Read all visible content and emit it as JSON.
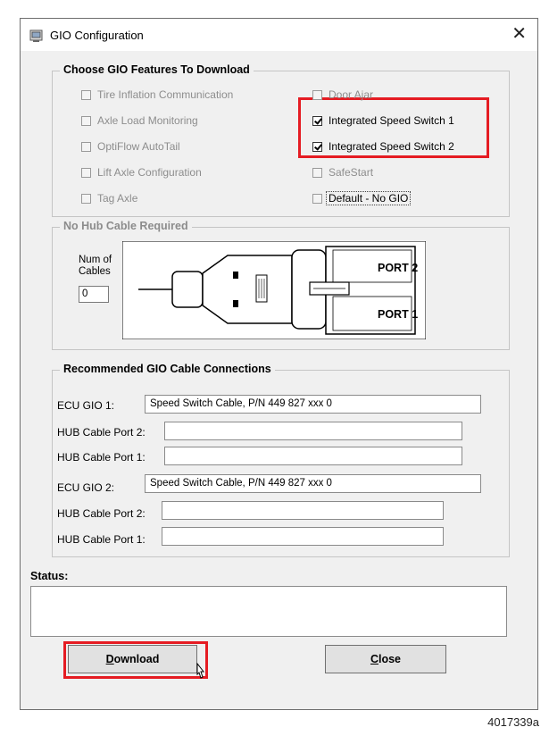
{
  "window": {
    "title": "GIO Configuration",
    "close_glyph": "✕"
  },
  "features": {
    "legend": "Choose GIO Features To Download",
    "left": [
      {
        "label": "Tire Inflation Communication",
        "checked": false,
        "enabled": false
      },
      {
        "label": "Axle Load Monitoring",
        "checked": false,
        "enabled": false
      },
      {
        "label": "OptiFlow AutoTail",
        "checked": false,
        "enabled": false
      },
      {
        "label": "Lift Axle Configuration",
        "checked": false,
        "enabled": false
      },
      {
        "label": "Tag Axle",
        "checked": false,
        "enabled": false
      }
    ],
    "right": [
      {
        "label": "Door Ajar",
        "checked": false,
        "enabled": false
      },
      {
        "label": "Integrated Speed Switch 1",
        "checked": true,
        "enabled": true
      },
      {
        "label": "Integrated Speed Switch 2",
        "checked": true,
        "enabled": true
      },
      {
        "label": "SafeStart",
        "checked": false,
        "enabled": false
      },
      {
        "label": "Default - No GIO",
        "checked": false,
        "enabled": true
      }
    ]
  },
  "hub": {
    "legend": "No Hub Cable Required",
    "num_label_line1": "Num of",
    "num_label_line2": "Cables",
    "num_value": "0",
    "port2_label": "PORT 2",
    "port1_label": "PORT 1"
  },
  "connections": {
    "legend": "Recommended GIO Cable Connections",
    "ecu1_label": "ECU GIO 1:",
    "ecu1_value": "Speed Switch Cable, P/N 449 827 xxx 0",
    "hub1_port2_label": "HUB Cable Port 2:",
    "hub1_port2_value": "",
    "hub1_port1_label": "HUB Cable Port 1:",
    "hub1_port1_value": "",
    "ecu2_label": "ECU GIO 2:",
    "ecu2_value": "Speed Switch Cable, P/N 449 827 xxx 0",
    "hub2_port2_label": "HUB Cable Port 2:",
    "hub2_port2_value": "",
    "hub2_port1_label": "HUB Cable Port 1:",
    "hub2_port1_value": ""
  },
  "status": {
    "label": "Status:",
    "value": ""
  },
  "buttons": {
    "download_mnemonic": "D",
    "download_rest": "ownload",
    "close_mnemonic": "C",
    "close_rest": "lose"
  },
  "caption": "4017339a",
  "colors": {
    "highlight": "#e51c23",
    "dialog_bg": "#f0f0f0"
  }
}
